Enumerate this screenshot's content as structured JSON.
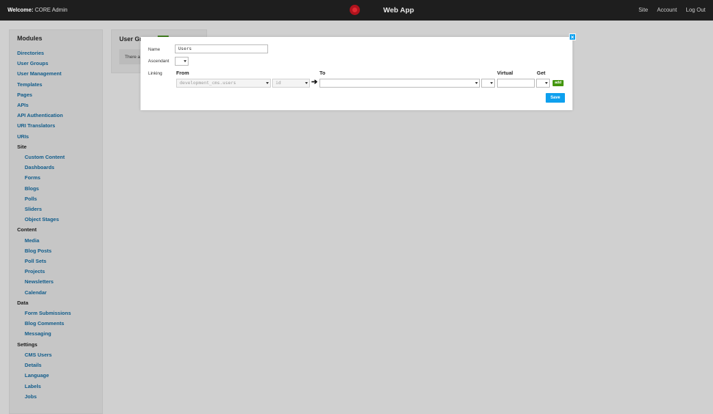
{
  "topbar": {
    "welcome_label": "Welcome:",
    "user_name": "CORE Admin",
    "app_title": "Web App",
    "links": [
      "Site",
      "Account",
      "Log Out"
    ]
  },
  "sidebar": {
    "title": "Modules",
    "items": [
      {
        "label": "Directories",
        "kind": "link"
      },
      {
        "label": "User Groups",
        "kind": "link"
      },
      {
        "label": "User Management",
        "kind": "link"
      },
      {
        "label": "Templates",
        "kind": "link"
      },
      {
        "label": "Pages",
        "kind": "link"
      },
      {
        "label": "APIs",
        "kind": "link"
      },
      {
        "label": "API Authentication",
        "kind": "link"
      },
      {
        "label": "URI Translators",
        "kind": "link"
      },
      {
        "label": "URIs",
        "kind": "link"
      },
      {
        "label": "Site",
        "kind": "section"
      },
      {
        "label": "Custom Content",
        "kind": "sub"
      },
      {
        "label": "Dashboards",
        "kind": "sub"
      },
      {
        "label": "Forms",
        "kind": "sub"
      },
      {
        "label": "Blogs",
        "kind": "sub"
      },
      {
        "label": "Polls",
        "kind": "sub"
      },
      {
        "label": "Sliders",
        "kind": "sub"
      },
      {
        "label": "Object Stages",
        "kind": "sub"
      },
      {
        "label": "Content",
        "kind": "section"
      },
      {
        "label": "Media",
        "kind": "sub"
      },
      {
        "label": "Blog Posts",
        "kind": "sub"
      },
      {
        "label": "Poll Sets",
        "kind": "sub"
      },
      {
        "label": "Projects",
        "kind": "sub"
      },
      {
        "label": "Newsletters",
        "kind": "sub"
      },
      {
        "label": "Calendar",
        "kind": "sub"
      },
      {
        "label": "Data",
        "kind": "section"
      },
      {
        "label": "Form Submissions",
        "kind": "sub"
      },
      {
        "label": "Blog Comments",
        "kind": "sub"
      },
      {
        "label": "Messaging",
        "kind": "sub"
      },
      {
        "label": "Settings",
        "kind": "section"
      },
      {
        "label": "CMS Users",
        "kind": "sub"
      },
      {
        "label": "Details",
        "kind": "sub"
      },
      {
        "label": "Language",
        "kind": "sub"
      },
      {
        "label": "Labels",
        "kind": "sub"
      },
      {
        "label": "Jobs",
        "kind": "sub"
      }
    ]
  },
  "panel": {
    "title": "User Gr",
    "notice": "There a"
  },
  "modal": {
    "name_label": "Name",
    "name_value": "Users",
    "ascendant_label": "Ascendant",
    "ascendant_value": "",
    "linking_label": "Linking",
    "col_from": "From",
    "col_to": "To",
    "col_virtual": "Virtual",
    "col_get": "Get",
    "from_table": "development_cms.users",
    "from_field": "id",
    "to_value": "",
    "to_field_value": "",
    "virtual_value": "",
    "get_value": "",
    "arrow_glyph": "➔",
    "add_label": "add",
    "save_label": "Save",
    "close_glyph": "×"
  },
  "colors": {
    "accent": "#0ea0ee",
    "add_green": "#43960e",
    "link_blue": "#0f5b8a",
    "topbar": "#1e1e1e"
  }
}
